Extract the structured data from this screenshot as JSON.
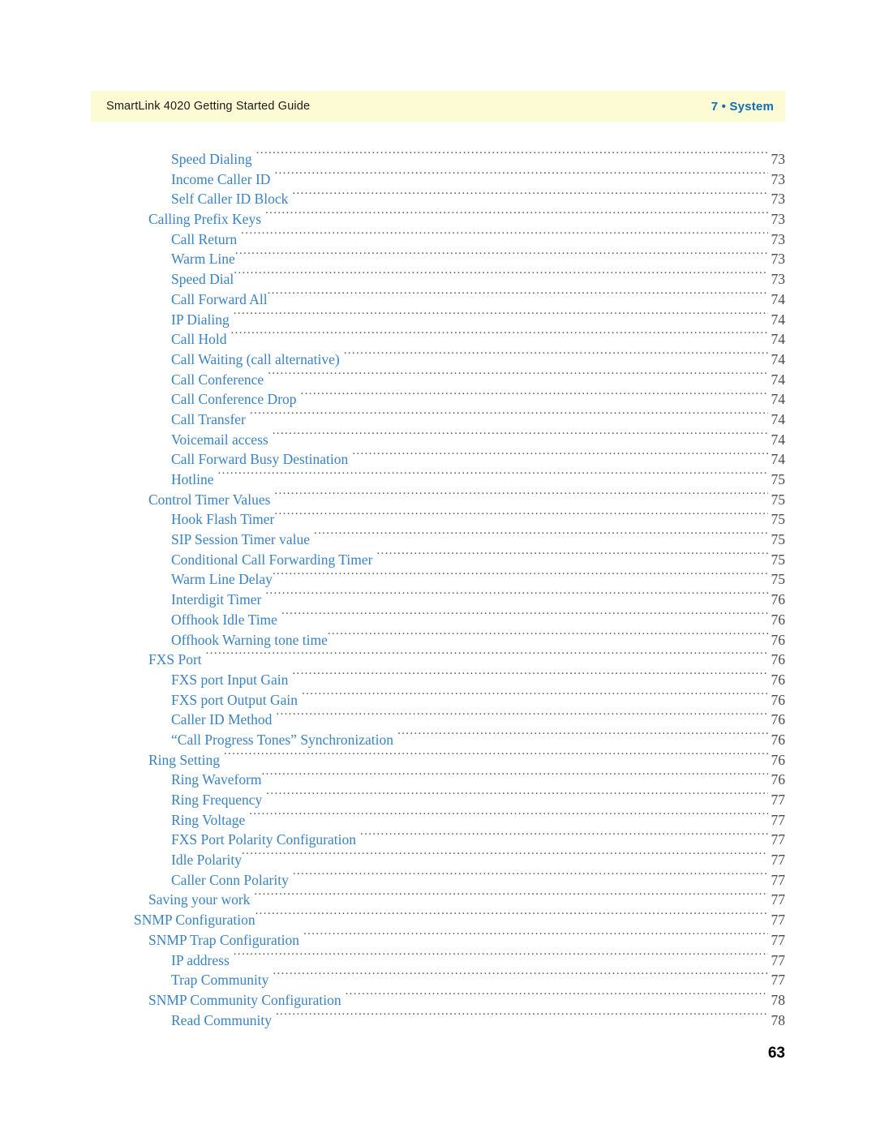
{
  "header": {
    "title": "SmartLink 4020 Getting Started Guide",
    "chapter": "7 • System",
    "band_color": "#fdfbd4",
    "chapter_color": "#0f6fb5"
  },
  "folio": {
    "page_number": "63"
  },
  "toc": {
    "link_color": "#3a83c3",
    "leader_color": "#58585a",
    "entries": [
      {
        "label": "Speed Dialing",
        "page": "73",
        "level": 2,
        "gap": true
      },
      {
        "label": "Income Caller ID",
        "page": "73",
        "level": 2,
        "gap": true
      },
      {
        "label": "Self Caller ID Block",
        "page": "73",
        "level": 2,
        "gap": true
      },
      {
        "label": "Calling Prefix Keys",
        "page": "73",
        "level": 1,
        "gap": true
      },
      {
        "label": "Call Return",
        "page": "73",
        "level": 2,
        "gap": true
      },
      {
        "label": "Warm Line",
        "page": "73",
        "level": 2,
        "gap": false
      },
      {
        "label": "Speed Dial",
        "page": "73",
        "level": 2,
        "gap": false
      },
      {
        "label": "Call Forward All",
        "page": "74",
        "level": 2,
        "gap": false
      },
      {
        "label": "IP Dialing",
        "page": "74",
        "level": 2,
        "gap": true
      },
      {
        "label": "Call Hold",
        "page": "74",
        "level": 2,
        "gap": true
      },
      {
        "label": "Call Waiting (call alternative)",
        "page": "74",
        "level": 2,
        "gap": true
      },
      {
        "label": "Call Conference",
        "page": "74",
        "level": 2,
        "gap": true
      },
      {
        "label": "Call Conference Drop",
        "page": "74",
        "level": 2,
        "gap": true
      },
      {
        "label": "Call Transfer",
        "page": "74",
        "level": 2,
        "gap": true
      },
      {
        "label": "Voicemail access",
        "page": "74",
        "level": 2,
        "gap": true
      },
      {
        "label": "Call Forward Busy Destination",
        "page": "74",
        "level": 2,
        "gap": true
      },
      {
        "label": "Hotline",
        "page": "75",
        "level": 2,
        "gap": true
      },
      {
        "label": "Control Timer Values",
        "page": "75",
        "level": 1,
        "gap": true
      },
      {
        "label": "Hook Flash Timer",
        "page": "75",
        "level": 2,
        "gap": false
      },
      {
        "label": "SIP Session Timer value",
        "page": "75",
        "level": 2,
        "gap": true
      },
      {
        "label": "Conditional Call Forwarding Timer",
        "page": "75",
        "level": 2,
        "gap": true
      },
      {
        "label": "Warm Line Delay",
        "page": "75",
        "level": 2,
        "gap": false
      },
      {
        "label": "Interdigit Timer",
        "page": "76",
        "level": 2,
        "gap": true
      },
      {
        "label": "Offhook Idle Time",
        "page": "76",
        "level": 2,
        "gap": true
      },
      {
        "label": "Offhook Warning tone time",
        "page": "76",
        "level": 2,
        "gap": false
      },
      {
        "label": "FXS Port",
        "page": "76",
        "level": 1,
        "gap": true
      },
      {
        "label": "FXS port Input Gain",
        "page": "76",
        "level": 2,
        "gap": true
      },
      {
        "label": "FXS port Output Gain",
        "page": "76",
        "level": 2,
        "gap": true
      },
      {
        "label": "Caller ID Method",
        "page": "76",
        "level": 2,
        "gap": true
      },
      {
        "label": "“Call Progress Tones” Synchronization",
        "page": "76",
        "level": 2,
        "gap": true
      },
      {
        "label": "Ring Setting",
        "page": "76",
        "level": 1,
        "gap": true
      },
      {
        "label": "Ring Waveform",
        "page": "76",
        "level": 2,
        "gap": false
      },
      {
        "label": "Ring Frequency",
        "page": "77",
        "level": 2,
        "gap": true
      },
      {
        "label": "Ring Voltage",
        "page": "77",
        "level": 2,
        "gap": true
      },
      {
        "label": "FXS Port Polarity Configuration",
        "page": "77",
        "level": 2,
        "gap": true
      },
      {
        "label": "Idle Polarity",
        "page": "77",
        "level": 2,
        "gap": false
      },
      {
        "label": "Caller Conn Polarity",
        "page": "77",
        "level": 2,
        "gap": true
      },
      {
        "label": "Saving your work",
        "page": "77",
        "level": 1,
        "gap": true
      },
      {
        "label": "SNMP Configuration",
        "page": "77",
        "level": 0,
        "gap": false
      },
      {
        "label": "SNMP Trap Configuration",
        "page": "77",
        "level": 1,
        "gap": true
      },
      {
        "label": "IP address",
        "page": "77",
        "level": 2,
        "gap": true
      },
      {
        "label": "Trap Community",
        "page": "77",
        "level": 2,
        "gap": true
      },
      {
        "label": "SNMP Community Configuration",
        "page": "78",
        "level": 1,
        "gap": true
      },
      {
        "label": "Read Community",
        "page": "78",
        "level": 2,
        "gap": true
      }
    ]
  }
}
